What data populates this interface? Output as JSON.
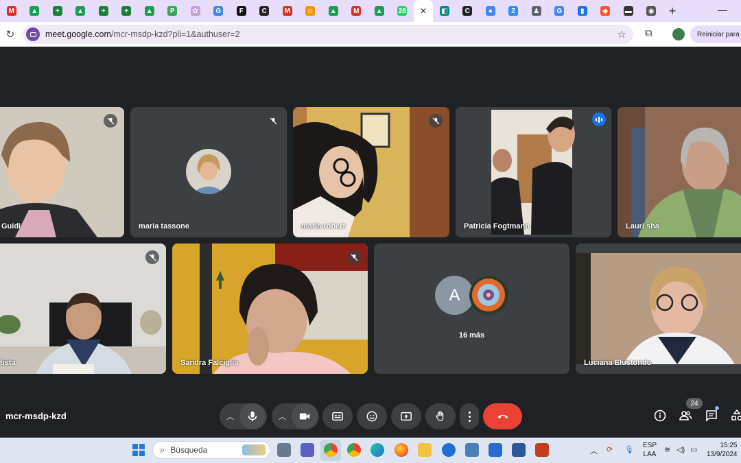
{
  "browser": {
    "tabs": [
      {
        "icon": "gmail-icon",
        "letter": "M",
        "color": "#d93025"
      },
      {
        "icon": "drive-icon",
        "letter": "▲",
        "color": "#1a9e52"
      },
      {
        "icon": "sheets-icon",
        "letter": "+",
        "color": "#188038"
      },
      {
        "icon": "drive-icon",
        "letter": "▲",
        "color": "#1a9e52"
      },
      {
        "icon": "sheets-icon",
        "letter": "+",
        "color": "#188038"
      },
      {
        "icon": "sheets-icon",
        "letter": "+",
        "color": "#188038"
      },
      {
        "icon": "drive-icon",
        "letter": "▲",
        "color": "#1a9e52"
      },
      {
        "icon": "pdf-icon",
        "letter": "P",
        "color": "#34a853"
      },
      {
        "icon": "bird-icon",
        "letter": "✿",
        "color": "#c6a0d8"
      },
      {
        "icon": "google-icon",
        "letter": "G",
        "color": "#4285f4"
      },
      {
        "icon": "f-icon",
        "letter": "F",
        "color": "#111111"
      },
      {
        "icon": "c-icon",
        "letter": "C",
        "color": "#222222"
      },
      {
        "icon": "gmail-icon",
        "letter": "M",
        "color": "#d93025"
      },
      {
        "icon": "emoji-icon",
        "letter": "☺",
        "color": "#f29900"
      },
      {
        "icon": "drive-icon",
        "letter": "▲",
        "color": "#1a9e52"
      },
      {
        "icon": "gmail-icon",
        "letter": "M",
        "color": "#d93025"
      },
      {
        "icon": "drive-icon",
        "letter": "▲",
        "color": "#1a9e52"
      },
      {
        "icon": "whatsapp-icon",
        "letter": "28",
        "color": "#25d366"
      }
    ],
    "tabs_after": [
      {
        "icon": "meet-icon",
        "letter": "◧",
        "color": "#00897b"
      },
      {
        "icon": "c-icon",
        "letter": "C",
        "color": "#222222"
      },
      {
        "icon": "app-icon",
        "letter": "●",
        "color": "#4285f4"
      },
      {
        "icon": "z-icon",
        "letter": "Z",
        "color": "#2d8cff"
      },
      {
        "icon": "bot-icon",
        "letter": "♟",
        "color": "#5f6368"
      },
      {
        "icon": "google-icon",
        "letter": "G",
        "color": "#4285f4"
      },
      {
        "icon": "files-icon",
        "letter": "▮",
        "color": "#1a73e8"
      },
      {
        "icon": "brave-icon",
        "letter": "◆",
        "color": "#fb542b"
      },
      {
        "icon": "ikea-icon",
        "letter": "▬",
        "color": "#333333"
      },
      {
        "icon": "chrome-icon",
        "letter": "◉",
        "color": "#555555"
      }
    ],
    "url_host": "meet.google.com",
    "url_path": "/mcr-msdp-kzd?pli=1&authuser=2",
    "restart_label": "Reiniciar para ac"
  },
  "participants": {
    "p1": "Guidi",
    "p2": "maria tassone",
    "p3": "maria robert",
    "p4": "Patricia Fogtmann",
    "p5": "Lauri sha",
    "p6": "tista",
    "p7": "Sandra Falciglia",
    "p8_avatar_letter": "A",
    "p8_more": "16 más",
    "p9": "Luciana Elustondo"
  },
  "meeting": {
    "code": "mcr-msdp-kzd",
    "people_count": "24"
  },
  "taskbar": {
    "search_placeholder": "Búsqueda",
    "lang_top": "ESP",
    "lang_bottom": "LAA",
    "time": "15:25",
    "date": "13/9/2024"
  },
  "colors": {
    "meet_bg": "#202124",
    "tile_bg": "#3c4043",
    "end_call": "#ea4335",
    "active_speaker": "#8ab4f8"
  }
}
